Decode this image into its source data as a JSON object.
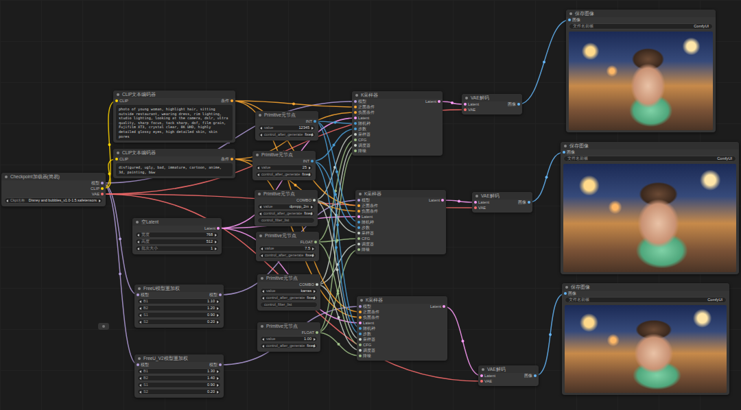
{
  "nodes": [
    {
      "kind": "checkpoint",
      "title": "Checkpoint加载器(简易)",
      "inputs": [],
      "outputs": [
        "模型",
        "CLIP",
        "VAE"
      ],
      "widgets": [
        {
          "kind": "combo",
          "label": "Ckpt名称",
          "value": "Disney and bubbles_v1.0-1.5.safetensors"
        }
      ]
    },
    {
      "kind": "clip",
      "title": "CLIP文本编码器",
      "inputs": [
        "CLIP"
      ],
      "outputs": [
        "条件"
      ],
      "widgets": [],
      "text": "photo of young woman, highlight hair, sitting outside restaurant, wearing dress, rim lighting, studio lighting, looking at the camera, dslr, ultra quality, sharp focus, tack sharp, dof, film grain, Fujifilm XT3, crystal clear, 8K UHD, highly detailed glossy eyes, high detailed skin, skin pores"
    },
    {
      "kind": "clip",
      "title": "CLIP文本编码器",
      "inputs": [
        "CLIP"
      ],
      "outputs": [
        "条件"
      ],
      "widgets": [],
      "text": "disfigured, ugly, bad, immature, cartoon, anime, 3d, painting, b&w"
    },
    {
      "kind": "latent",
      "title": "空Latent",
      "inputs": [],
      "outputs": [
        "Latent"
      ],
      "widgets": [
        {
          "kind": "number",
          "label": "宽度",
          "value": "768"
        },
        {
          "kind": "number",
          "label": "高度",
          "value": "512"
        },
        {
          "kind": "number",
          "label": "批次大小",
          "value": "1"
        }
      ]
    },
    {
      "kind": "freeu",
      "title": "FreeU模型重加权",
      "inputs": [
        "模型"
      ],
      "outputs": [
        "模型"
      ],
      "widgets": [
        {
          "kind": "number",
          "label": "B1",
          "value": "1.10"
        },
        {
          "kind": "number",
          "label": "B2",
          "value": "1.20"
        },
        {
          "kind": "number",
          "label": "S1",
          "value": "0.90"
        },
        {
          "kind": "number",
          "label": "S2",
          "value": "0.20"
        }
      ]
    },
    {
      "kind": "freeu",
      "title": "FreeU_V2模型重加权",
      "inputs": [
        "模型"
      ],
      "outputs": [
        "模型"
      ],
      "widgets": [
        {
          "kind": "number",
          "label": "B1",
          "value": "1.30"
        },
        {
          "kind": "number",
          "label": "B2",
          "value": "1.40"
        },
        {
          "kind": "number",
          "label": "S1",
          "value": "0.90"
        },
        {
          "kind": "number",
          "label": "S2",
          "value": "0.20"
        }
      ]
    },
    {
      "kind": "primitive",
      "title": "Primitive元节点",
      "inputs": [],
      "outputs": [
        "INT"
      ],
      "widgets": [
        {
          "kind": "number",
          "label": "value",
          "value": "12345"
        },
        {
          "kind": "combo",
          "label": "control_after_generate",
          "value": "fixed"
        }
      ]
    },
    {
      "kind": "primitive",
      "title": "Primitive元节点",
      "inputs": [],
      "outputs": [
        "INT"
      ],
      "widgets": [
        {
          "kind": "number",
          "label": "value",
          "value": "25"
        },
        {
          "kind": "combo",
          "label": "control_after_generate",
          "value": "fixed"
        }
      ]
    },
    {
      "kind": "primitive",
      "title": "Primitive元节点",
      "inputs": [],
      "outputs": [
        "COMBO"
      ],
      "widgets": [
        {
          "kind": "combo",
          "label": "value",
          "value": "dpmpp_2m"
        },
        {
          "kind": "combo",
          "label": "control_after_generate",
          "value": "fixed"
        },
        {
          "kind": "text",
          "label": "control_filter_list"
        }
      ]
    },
    {
      "kind": "primitive",
      "title": "Primitive元节点",
      "inputs": [],
      "outputs": [
        "FLOAT"
      ],
      "widgets": [
        {
          "kind": "number",
          "label": "value",
          "value": "7.5"
        },
        {
          "kind": "combo",
          "label": "control_after_generate",
          "value": "fixed"
        }
      ]
    },
    {
      "kind": "primitive",
      "title": "Primitive元节点",
      "inputs": [],
      "outputs": [
        "COMBO"
      ],
      "widgets": [
        {
          "kind": "combo",
          "label": "value",
          "value": "karras"
        },
        {
          "kind": "combo",
          "label": "control_after_generate",
          "value": "fixed"
        },
        {
          "kind": "text",
          "label": "control_filter_list"
        }
      ]
    },
    {
      "kind": "primitive",
      "title": "Primitive元节点",
      "inputs": [],
      "outputs": [
        "FLOAT"
      ],
      "widgets": [
        {
          "kind": "number",
          "label": "value",
          "value": "1.00"
        },
        {
          "kind": "combo",
          "label": "control_after_generate",
          "value": "fixed"
        }
      ]
    },
    {
      "kind": "ksampler",
      "title": "K采样器",
      "inputs": [
        "模型",
        "正面条件",
        "负面条件",
        "Latent",
        "随机种",
        "步数",
        "采样器",
        "CFG",
        "调度器",
        "降噪"
      ],
      "outputs": [
        "Latent"
      ],
      "widgets": []
    },
    {
      "kind": "ksampler",
      "title": "K采样器",
      "inputs": [
        "模型",
        "正面条件",
        "负面条件",
        "Latent",
        "随机种",
        "步数",
        "采样器",
        "CFG",
        "调度器",
        "降噪"
      ],
      "outputs": [
        "Latent"
      ],
      "widgets": []
    },
    {
      "kind": "ksampler",
      "title": "K采样器",
      "inputs": [
        "模型",
        "正面条件",
        "负面条件",
        "Latent",
        "随机种",
        "步数",
        "采样器",
        "CFG",
        "调度器",
        "降噪"
      ],
      "outputs": [
        "Latent"
      ],
      "widgets": []
    },
    {
      "kind": "vae",
      "title": "VAE解码",
      "inputs": [
        "Latent",
        "VAE"
      ],
      "outputs": [
        "图像"
      ],
      "widgets": []
    },
    {
      "kind": "vae",
      "title": "VAE解码",
      "inputs": [
        "Latent",
        "VAE"
      ],
      "outputs": [
        "图像"
      ],
      "widgets": []
    },
    {
      "kind": "vae",
      "title": "VAE解码",
      "inputs": [
        "Latent",
        "VAE"
      ],
      "outputs": [
        "图像"
      ],
      "widgets": []
    },
    {
      "kind": "save",
      "title": "保存图像",
      "inputs": [
        "图像"
      ],
      "outputs": [],
      "widgets": [
        {
          "kind": "text",
          "label": "文件名前缀",
          "value": "ComfyUI"
        }
      ]
    },
    {
      "kind": "save",
      "title": "保存图像",
      "inputs": [
        "图像"
      ],
      "outputs": [],
      "widgets": [
        {
          "kind": "text",
          "label": "文件名前缀",
          "value": "ComfyUI"
        }
      ]
    },
    {
      "kind": "save",
      "title": "保存图像",
      "inputs": [
        "图像"
      ],
      "outputs": [],
      "widgets": [
        {
          "kind": "text",
          "label": "文件名前缀",
          "value": "ComfyUI"
        }
      ]
    }
  ]
}
